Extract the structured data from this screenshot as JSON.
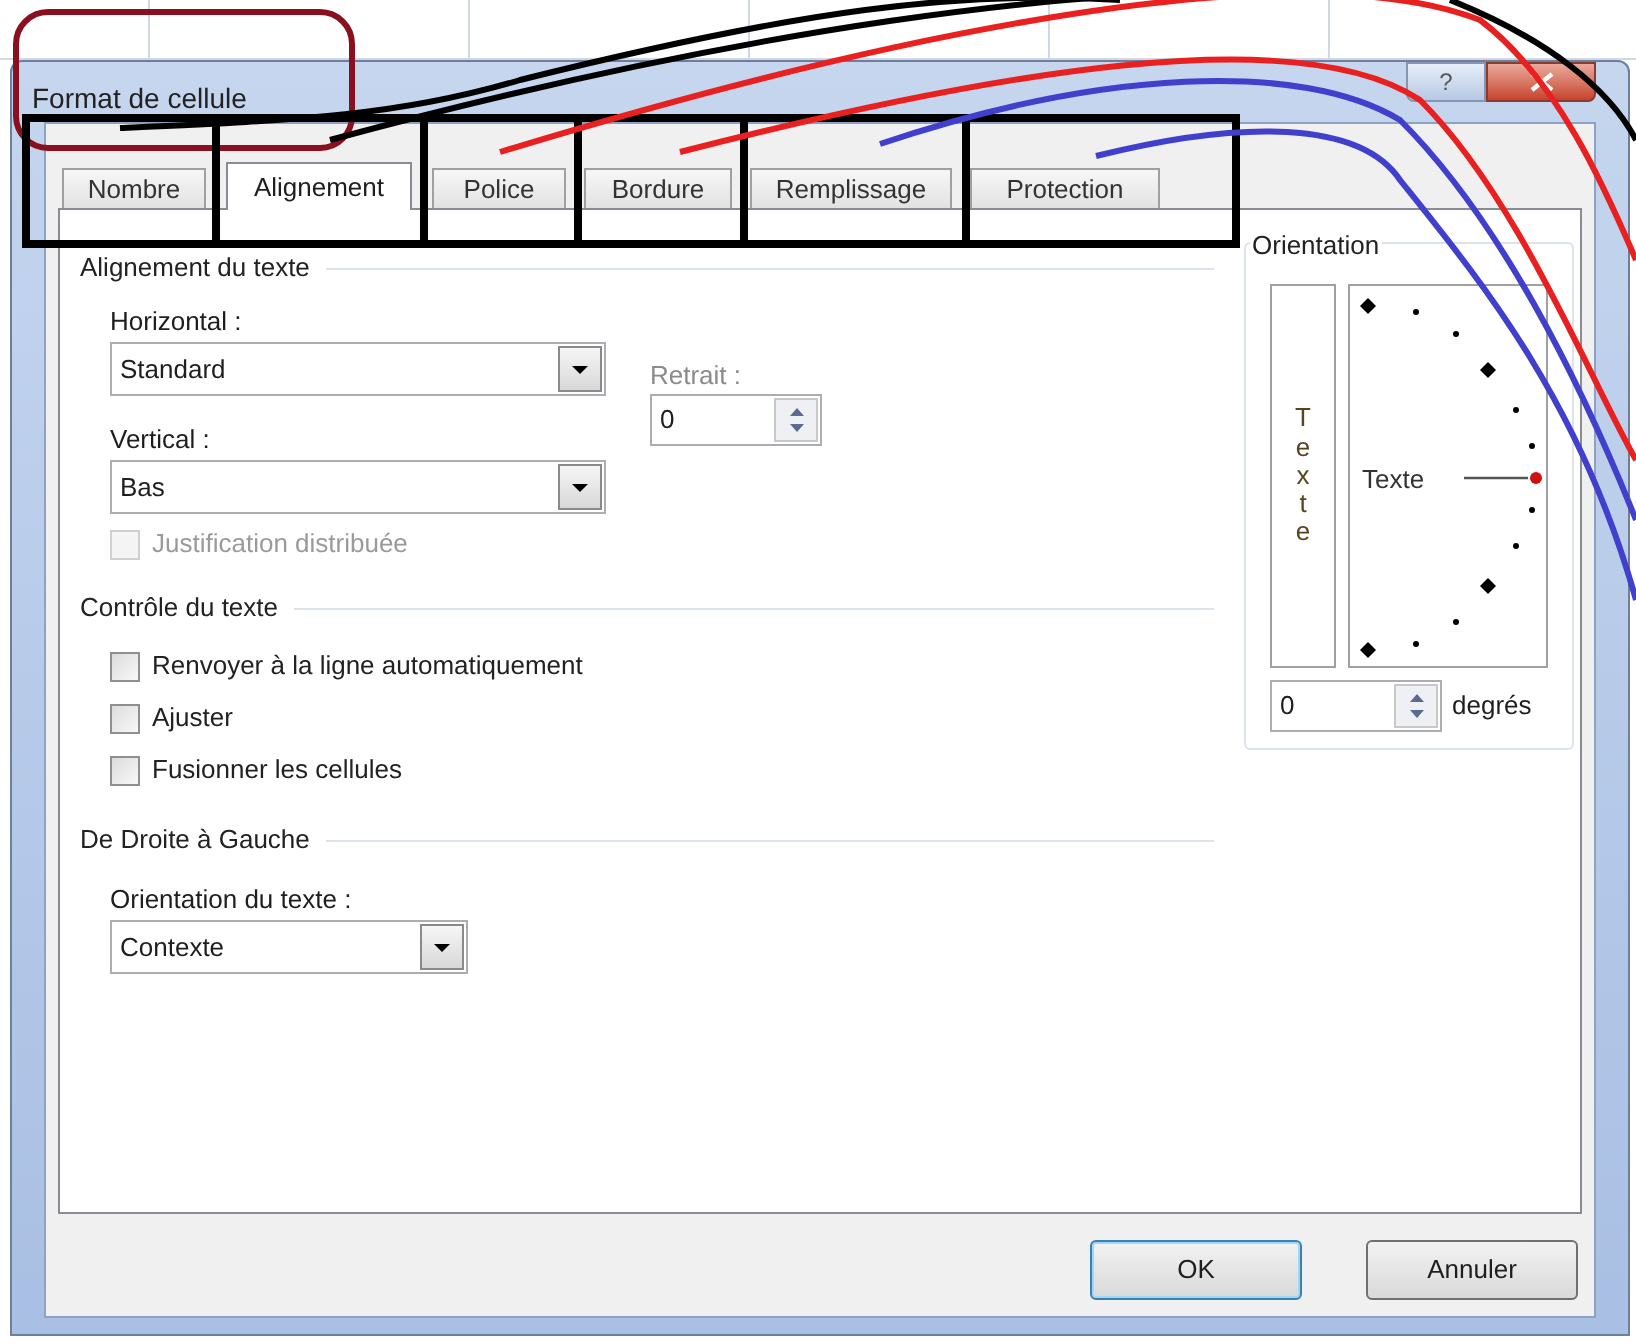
{
  "window": {
    "title": "Format de cellule",
    "help": "?"
  },
  "tabs": [
    {
      "label": "Nombre",
      "selected": false
    },
    {
      "label": "Alignement",
      "selected": true
    },
    {
      "label": "Police",
      "selected": false
    },
    {
      "label": "Bordure",
      "selected": false
    },
    {
      "label": "Remplissage",
      "selected": false
    },
    {
      "label": "Protection",
      "selected": false
    }
  ],
  "alignment": {
    "title": "Alignement du texte",
    "horizontal": {
      "label": "Horizontal :",
      "value": "Standard"
    },
    "indent": {
      "label": "Retrait :",
      "value": "0"
    },
    "vertical": {
      "label": "Vertical :",
      "value": "Bas"
    },
    "options": [
      {
        "label": "Justification distribuée",
        "checked": false,
        "disabled": true
      }
    ]
  },
  "text_control": {
    "title": "Contrôle du texte",
    "options": [
      {
        "label": "Renvoyer à la ligne automatiquement",
        "checked": false,
        "disabled": false
      },
      {
        "label": "Ajuster",
        "checked": false,
        "disabled": false
      },
      {
        "label": "Fusionner les cellules",
        "checked": false,
        "disabled": false
      }
    ]
  },
  "right_to_left": {
    "title": "De Droite à Gauche",
    "direction": {
      "label": "Orientation du texte :",
      "value": "Contexte"
    }
  },
  "orientation": {
    "title": "Orientation",
    "vertical_text": "Texte",
    "dial_text": "Texte",
    "degrees": {
      "value": "0",
      "unit": "degrés"
    }
  },
  "buttons": [
    {
      "label": "OK",
      "default": true
    },
    {
      "label": "Annuler",
      "default": false
    }
  ]
}
